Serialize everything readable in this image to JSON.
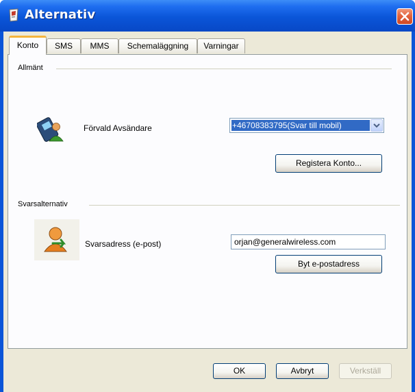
{
  "window": {
    "title": "Alternativ",
    "icons": {
      "app": "app-icon",
      "close": "close-icon"
    }
  },
  "tabs": [
    {
      "label": "Konto",
      "active": true
    },
    {
      "label": "SMS",
      "active": false
    },
    {
      "label": "MMS",
      "active": false
    },
    {
      "label": "Schemaläggning",
      "active": false
    },
    {
      "label": "Varningar",
      "active": false
    }
  ],
  "general": {
    "group_title": "Allmänt",
    "icon": "sender-phone-icon",
    "default_sender_label": "Förvald Avsändare",
    "default_sender_value": "+46708383795(Svar till mobil)",
    "register_button": "Registera Konto..."
  },
  "reply": {
    "group_title": "Svarsalternativ",
    "icon": "reply-user-icon",
    "reply_address_label": "Svarsadress (e-post)",
    "reply_address_value": "orjan@generalwireless.com",
    "change_email_button": "Byt e-postadress"
  },
  "footer": {
    "ok": "OK",
    "cancel": "Avbryt",
    "apply": "Verkställ"
  },
  "colors": {
    "titlebar": "#0a55d8",
    "dialog_bg": "#ece9d8",
    "selection": "#316ac5",
    "close_button": "#e3643f",
    "tab_highlight": "#f5b43c"
  }
}
